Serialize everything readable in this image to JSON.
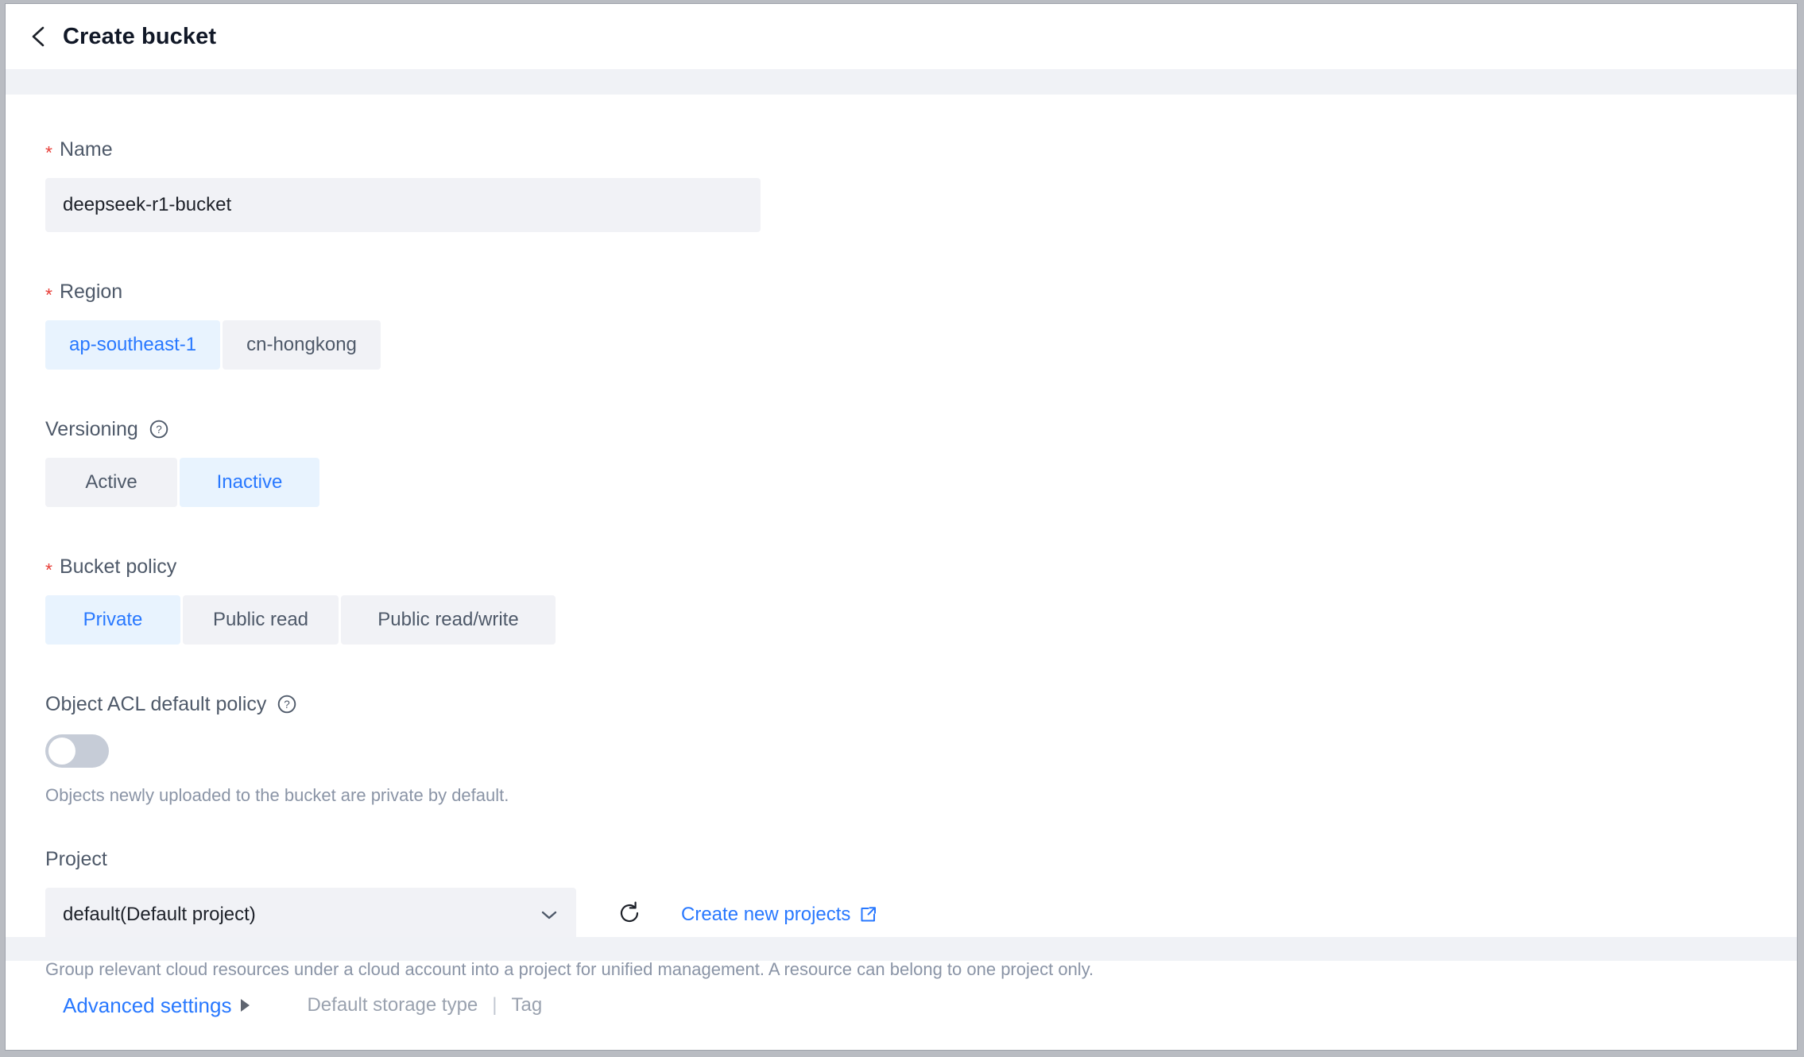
{
  "header": {
    "back_icon": "chevron-left-icon",
    "title": "Create bucket"
  },
  "form": {
    "name": {
      "label": "Name",
      "required": true,
      "value": "deepseek-r1-bucket"
    },
    "region": {
      "label": "Region",
      "required": true,
      "options": [
        "ap-southeast-1",
        "cn-hongkong"
      ],
      "selected": "ap-southeast-1"
    },
    "versioning": {
      "label": "Versioning",
      "required": false,
      "help_icon": "question-circle-icon",
      "options": [
        "Active",
        "Inactive"
      ],
      "selected": "Inactive"
    },
    "bucket_policy": {
      "label": "Bucket policy",
      "required": true,
      "options": [
        "Private",
        "Public read",
        "Public read/write"
      ],
      "selected": "Private"
    },
    "object_acl": {
      "label": "Object ACL default policy",
      "help_icon": "question-circle-icon",
      "toggle_on": false,
      "hint": "Objects newly uploaded to the bucket are private by default."
    },
    "project": {
      "label": "Project",
      "value": "default(Default project)",
      "chevron_icon": "chevron-down-icon",
      "refresh_icon": "refresh-icon",
      "link_label": "Create new projects",
      "link_icon": "external-link-icon",
      "hint": "Group relevant cloud resources under a cloud account into a project for unified management. A resource can belong to one project only."
    }
  },
  "footer": {
    "advanced_label": "Advanced settings",
    "advanced_arrow": "triangle-right-icon",
    "sub_items": [
      "Default storage type",
      "Tag"
    ],
    "separator": "|"
  },
  "colors": {
    "accent": "#2878ff",
    "required": "#e8403a",
    "selected_bg": "#e8f3fe",
    "control_bg": "#f1f2f6",
    "band": "#f0f2f6",
    "label": "#4e5969",
    "hint": "#8a94a6"
  }
}
